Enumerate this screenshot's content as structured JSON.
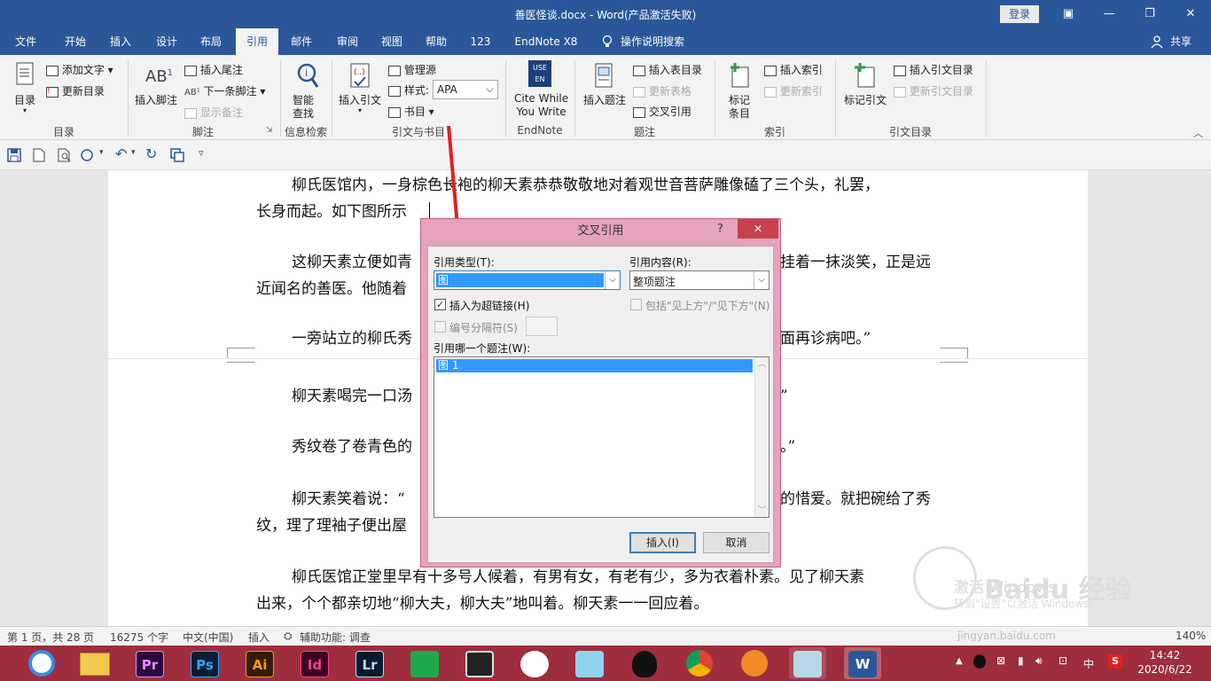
{
  "title_bar": {
    "title": "善医怪谈.docx  -  Word(产品激活失败)",
    "login": "登录",
    "controls": [
      "▣",
      "—",
      "❐",
      "✕"
    ]
  },
  "tabs": [
    {
      "label": "文件"
    },
    {
      "label": "开始"
    },
    {
      "label": "插入"
    },
    {
      "label": "设计"
    },
    {
      "label": "布局"
    },
    {
      "label": "引用",
      "active": true
    },
    {
      "label": "邮件"
    },
    {
      "label": "审阅"
    },
    {
      "label": "视图"
    },
    {
      "label": "帮助"
    },
    {
      "label": "123"
    },
    {
      "label": "EndNote X8"
    }
  ],
  "tell_me": "操作说明搜索",
  "share": "共享",
  "ribbon": {
    "toc": {
      "big": "目录",
      "add_text": "添加文字",
      "update_table": "更新目录",
      "group": "目录"
    },
    "footnotes": {
      "insert_footnote": "插入脚注",
      "insert_endnote": "插入尾注",
      "next_footnote": "下一条脚注",
      "show_notes": "显示备注",
      "group": "脚注"
    },
    "research": {
      "smart_lookup": "智能\n查找",
      "group": "信息检索"
    },
    "citations": {
      "insert_citation": "插入引文",
      "manage_sources": "管理源",
      "style_label": "样式:",
      "style_value": "APA",
      "bibliography": "书目",
      "group": "引文与书目"
    },
    "endnote": {
      "cite_while": "Cite While\nYou Write",
      "group": "EndNote",
      "icon_text": "USE EN"
    },
    "captions": {
      "insert_caption": "插入题注",
      "insert_table_figures": "插入表目录",
      "update_table": "更新表格",
      "cross_reference": "交叉引用",
      "group": "题注"
    },
    "index": {
      "mark_entry": "标记\n条目",
      "insert_index": "插入索引",
      "update_index": "更新索引",
      "group": "索引"
    },
    "toa": {
      "mark_citation": "标记引文",
      "insert_toa": "插入引文目录",
      "update_toa": "更新引文目录",
      "group": "引文目录"
    }
  },
  "document": {
    "p1": "柳氏医馆内，一身棕色长袍的柳天素恭恭敬敬地对着观世音菩萨雕像磕了三个头，礼罢，",
    "p1b": "长身而起。如下图所示",
    "p2a": "这柳天素立便如青",
    "p2a_end": "挂着一抹淡笑，正是远",
    "p2b": "近闻名的善医。他随着",
    "p3a": "一旁站立的柳氏秀",
    "p3a_end": "面再诊病吧。”",
    "p4a": "柳天素喝完一口汤",
    "p4a_end": "”",
    "p5a": "秀纹卷了卷青色的",
    "p5a_end": "。”",
    "p6a": "柳天素笑着说：“",
    "p6a_end": "的惜爱。就把碗给了秀",
    "p6b": "纹，理了理袖子便出屋",
    "p7a": "柳氏医馆正堂里早有十多号人候着，有男有女，有老有少，多为衣着朴素。见了柳天素",
    "p7b": "出来，个个都亲切地“柳大夫，柳大夫”地叫着。柳天素一一回应着。"
  },
  "dialog": {
    "title": "交叉引用",
    "help": "?",
    "close": "✕",
    "ref_type_label": "引用类型(T):",
    "ref_type_value": "图",
    "ref_content_label": "引用内容(R):",
    "ref_content_value": "整项题注",
    "insert_hyperlink": "插入为超链接(H)",
    "include_above_below": "包括\"见上方\"/\"见下方\"(N)",
    "separate_numbers": "编号分隔符(S)",
    "which_caption_label": "引用哪一个题注(W):",
    "caption_items": [
      "图 1"
    ],
    "insert_btn": "插入(I)",
    "cancel_btn": "取消"
  },
  "status_bar": {
    "page": "第 1 页，共 28 页",
    "words": "16275 个字",
    "lang": "中文(中国)",
    "mode": "插入",
    "accessibility": "辅助功能: 调查",
    "zoom": "140%"
  },
  "watermark": {
    "activate": "激活 Windows",
    "activate_sub": "转到\"设置\"以激活 Windows。",
    "site": "jingyan.baidu.com",
    "brand": "Baidu 经验"
  },
  "taskbar": {
    "apps": [
      "Pr",
      "Ps",
      "Ai",
      "Id",
      "Lr"
    ],
    "time": "14:42",
    "date": "2020/6/22",
    "ime": "中"
  }
}
